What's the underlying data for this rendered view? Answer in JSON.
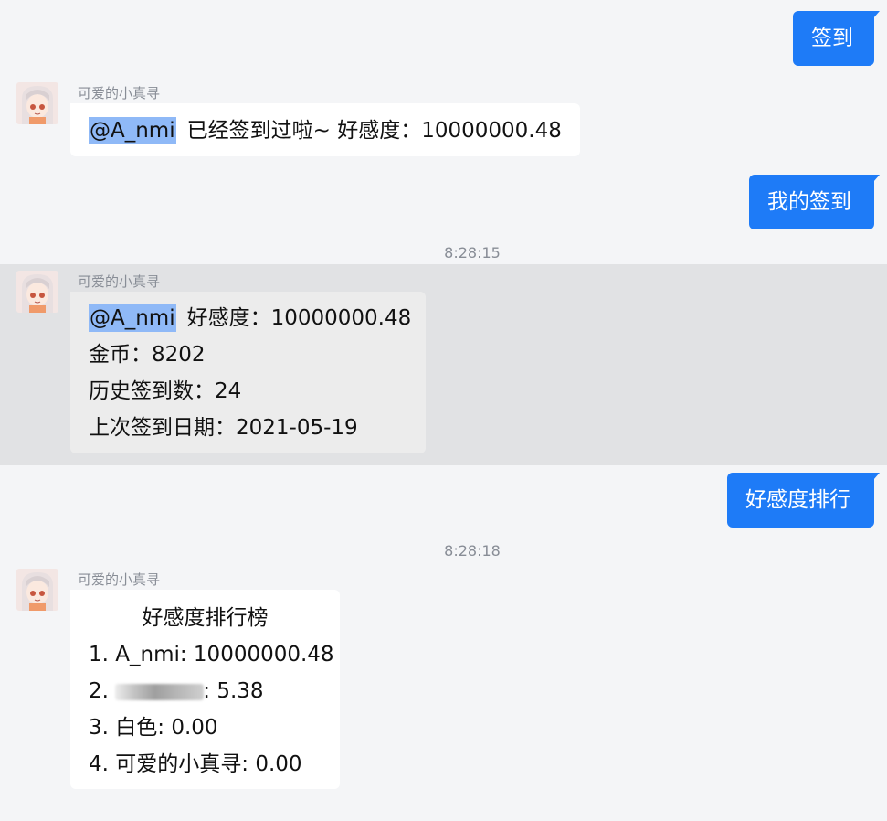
{
  "messages": {
    "out1": "签到",
    "out2": "我的签到",
    "out3": "好感度排行"
  },
  "bot": {
    "name": "可爱的小真寻"
  },
  "mention": "@A_nmi",
  "reply1": {
    "text": "已经签到过啦~ 好感度：10000000.48"
  },
  "time1": "8:28:15",
  "reply2": {
    "lines": [
      "好感度：10000000.48",
      "金币：8202",
      "历史签到数：24",
      "上次签到日期：2021-05-19"
    ]
  },
  "time2": "8:28:18",
  "reply3": {
    "title": "好感度排行榜",
    "rows": [
      "1. A_nmi: 10000000.48",
      "2. ",
      ": 5.38",
      "3. 白色: 0.00",
      "4. 可爱的小真寻: 0.00"
    ]
  },
  "colors": {
    "outgoing": "#1e7bf7",
    "background": "#f4f5f7",
    "mention_highlight": "#8fb9f7",
    "selected_row": "#e1e2e4"
  },
  "icons": {
    "avatar": "anime-girl-avatar"
  }
}
